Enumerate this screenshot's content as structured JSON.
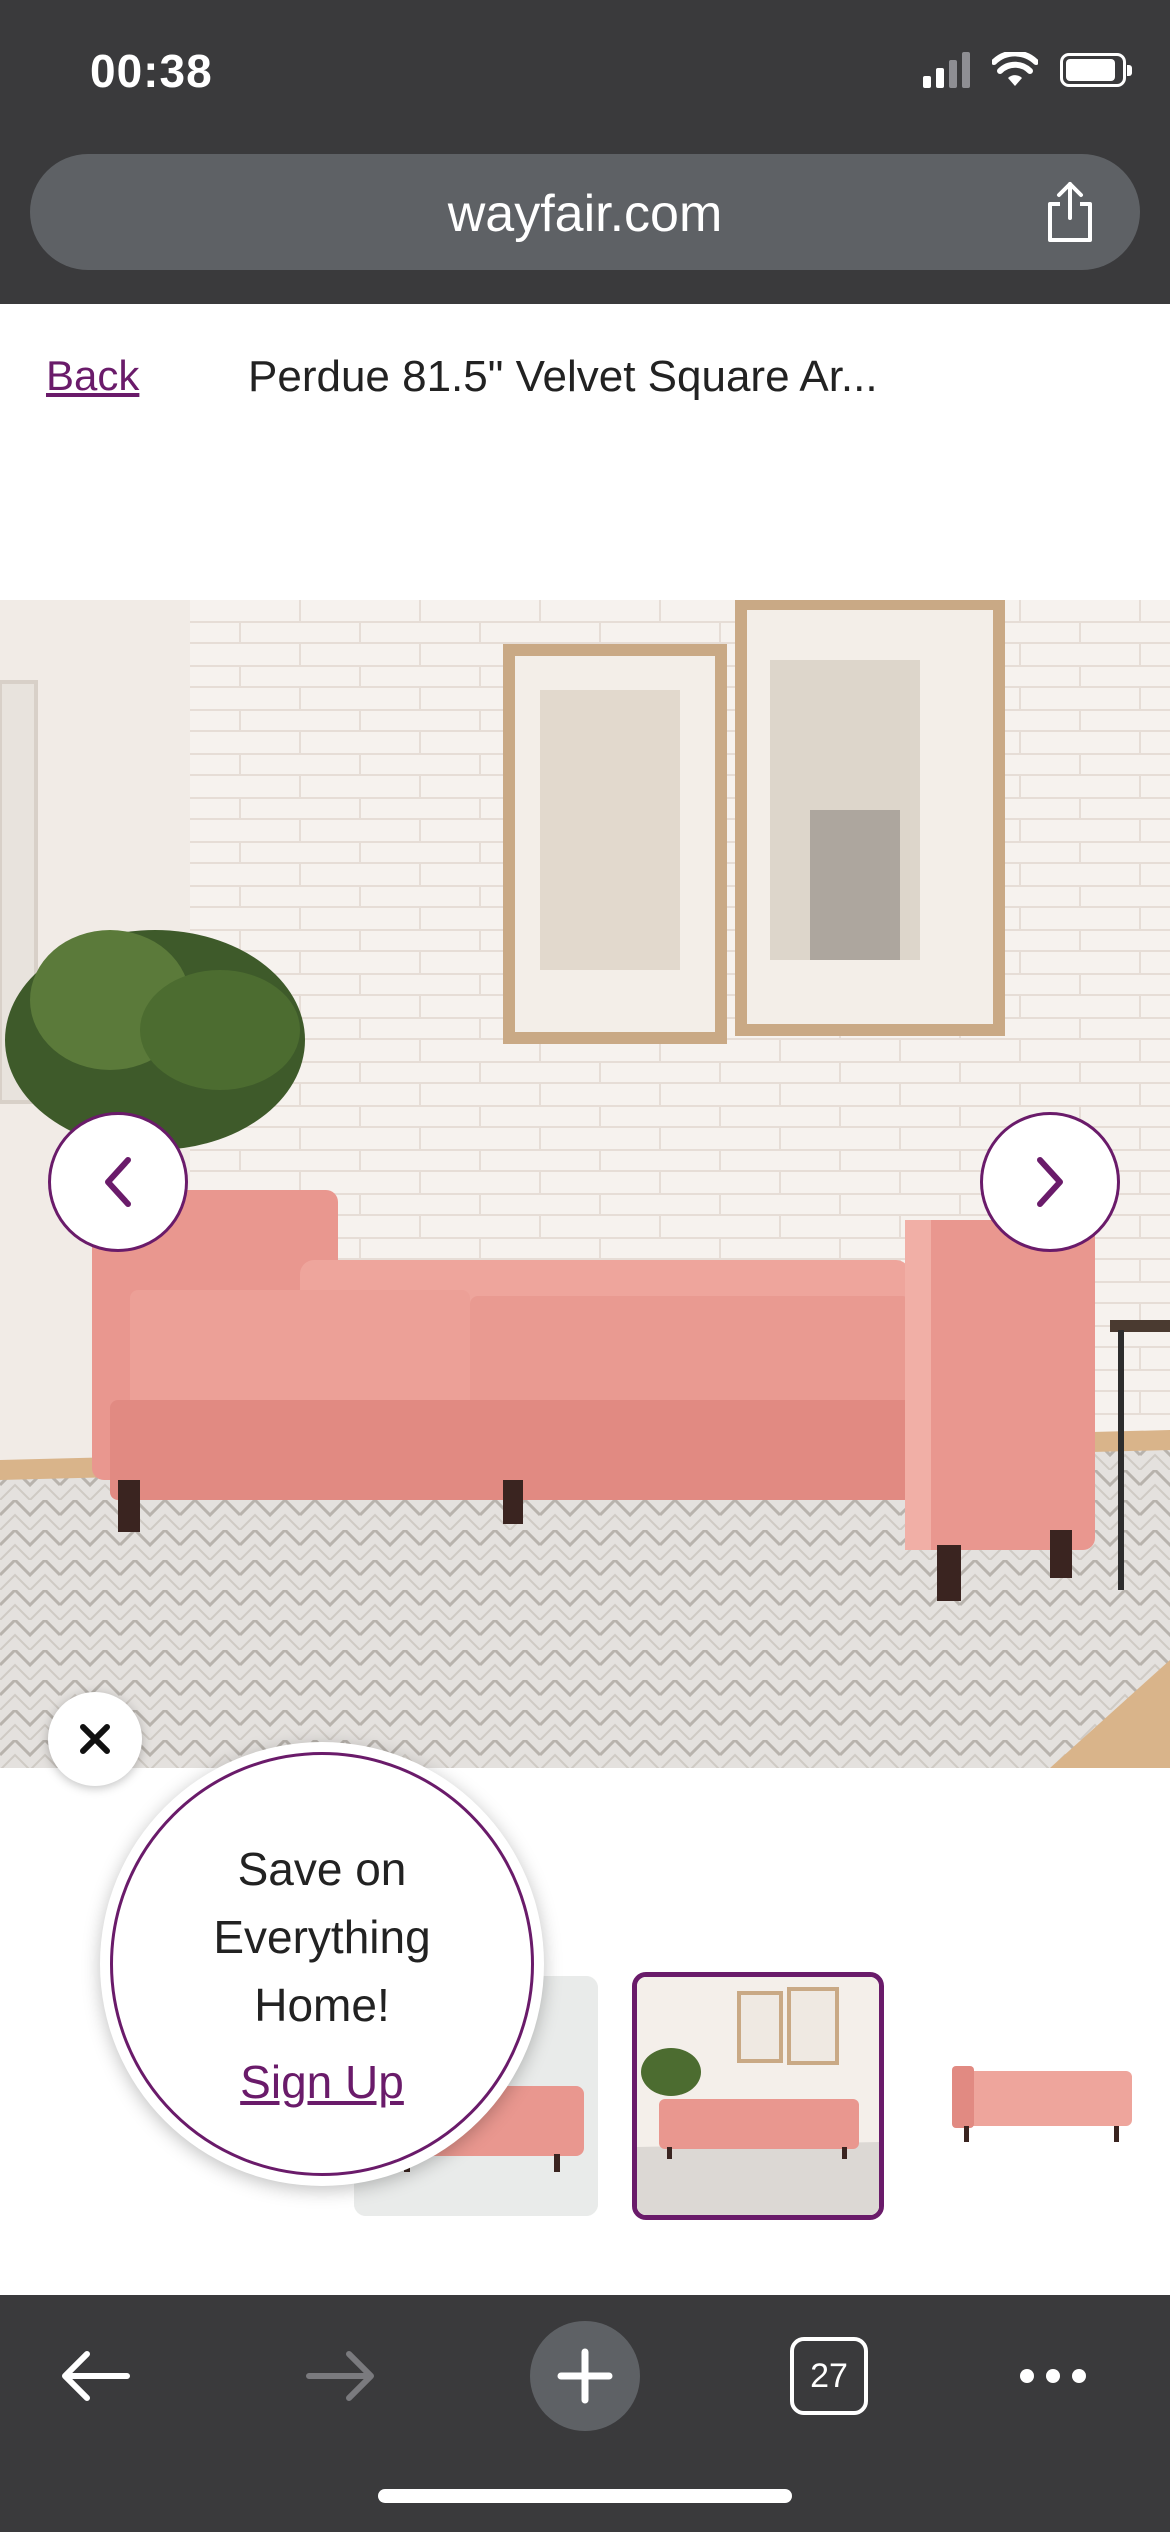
{
  "status_bar": {
    "time": "00:38",
    "icons": [
      "cellular-signal-icon",
      "wifi-icon",
      "battery-icon"
    ]
  },
  "browser": {
    "url": "wayfair.com",
    "share_icon": "share-icon",
    "tab_count": "27",
    "toolbar_icons": [
      "back-arrow-icon",
      "forward-arrow-icon",
      "plus-icon",
      "tabs-icon",
      "more-icon"
    ]
  },
  "page": {
    "back_label": "Back",
    "product_title": "Perdue 81.5\" Velvet Square Ar..."
  },
  "gallery": {
    "prev_icon": "chevron-left-icon",
    "next_icon": "chevron-right-icon",
    "selected_thumbnail": 2,
    "thumbnail_count": 3
  },
  "promo": {
    "line1": "Save on",
    "line2": "Everything",
    "line3": "Home!",
    "link": "Sign Up",
    "close_icon": "close-icon"
  },
  "colors": {
    "brand_purple": "#6a1b6a",
    "sofa_pink": "#e9978f",
    "chrome_dark": "#3a3a3c"
  }
}
